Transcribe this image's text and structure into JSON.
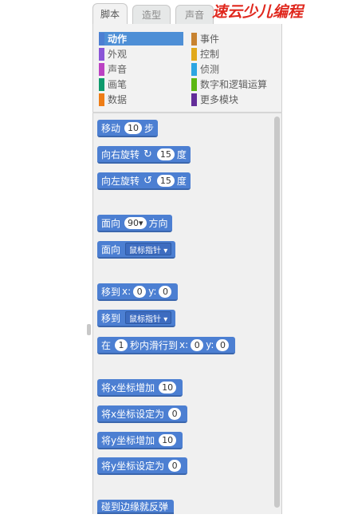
{
  "tabs": [
    {
      "label": "脚本"
    },
    {
      "label": "造型"
    },
    {
      "label": "声音"
    }
  ],
  "logo": {
    "text": "速云少儿编程",
    "color": "#e0281e"
  },
  "categories": [
    {
      "label": "动作",
      "color": "#4c7fd2"
    },
    {
      "label": "外观",
      "color": "#8a55d7"
    },
    {
      "label": "声音",
      "color": "#bb42c3"
    },
    {
      "label": "画笔",
      "color": "#0e9a6c"
    },
    {
      "label": "数据",
      "color": "#ee7d16"
    },
    {
      "label": "事件",
      "color": "#c88330"
    },
    {
      "label": "控制",
      "color": "#e1a91a"
    },
    {
      "label": "侦测",
      "color": "#2ca5e2"
    },
    {
      "label": "数字和逻辑运算",
      "color": "#5cb712"
    },
    {
      "label": "更多模块",
      "color": "#632d99"
    }
  ],
  "blocks": {
    "move": {
      "label": "移动",
      "value": "10",
      "suffix": "步"
    },
    "turn_right": {
      "label": "向右旋转",
      "icon": "rotate-cw-icon",
      "value": "15",
      "suffix": "度"
    },
    "turn_left": {
      "label": "向左旋转",
      "icon": "rotate-ccw-icon",
      "value": "15",
      "suffix": "度"
    },
    "point_dir": {
      "label": "面向",
      "value": "90▾",
      "suffix": "方向"
    },
    "point_towards": {
      "label": "面向",
      "dropdown": "鼠标指针 ▾"
    },
    "goto_xy": {
      "label": "移到",
      "x_label": "x:",
      "x": "0",
      "y_label": "y:",
      "y": "0"
    },
    "goto": {
      "label": "移到",
      "dropdown": "鼠标指针 ▾"
    },
    "glide": {
      "prefix": "在",
      "secs": "1",
      "label": "秒内滑行到",
      "x_label": "x:",
      "x": "0",
      "y_label": "y:",
      "y": "0"
    },
    "change_x": {
      "label": "将x坐标增加",
      "value": "10"
    },
    "set_x": {
      "label": "将x坐标设定为",
      "value": "0"
    },
    "change_y": {
      "label": "将y坐标增加",
      "value": "10"
    },
    "set_y": {
      "label": "将y坐标设定为",
      "value": "0"
    },
    "bounce": {
      "label": "碰到边缘就反弹"
    }
  }
}
